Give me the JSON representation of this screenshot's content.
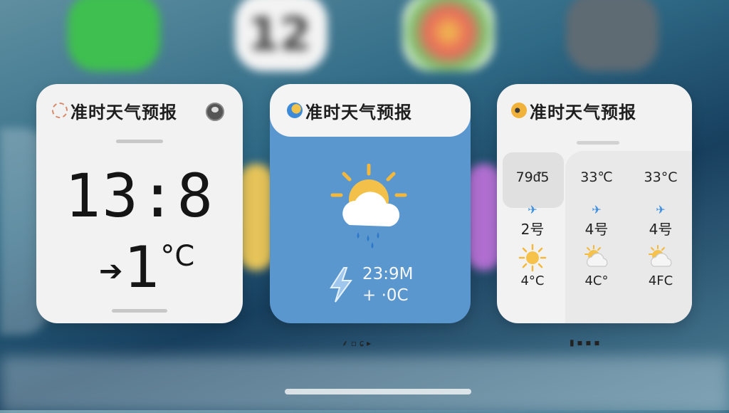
{
  "widgets": [
    {
      "title": "准时天气预报",
      "time": "13:8",
      "temp_arrow": "➔",
      "temp_value": "1",
      "temp_unit": "°C"
    },
    {
      "title": "准时天气预报",
      "line1": "23:9M",
      "line2": "+ ·0C",
      "icon": "partly-cloudy-rain-icon"
    },
    {
      "title": "准时天气预报",
      "columns": [
        {
          "temp": "79ᵭ5",
          "arrow": "✈",
          "level": "2号",
          "icon": "sun-icon",
          "low": "4°C"
        },
        {
          "temp": "33℃",
          "arrow": "✈",
          "level": "4号",
          "icon": "partly-cloudy-icon",
          "low": "4C°"
        },
        {
          "temp": "33°C",
          "arrow": "✈",
          "level": "4号",
          "icon": "partly-cloudy-icon",
          "low": "4FC"
        }
      ]
    }
  ],
  "page_indicators": {
    "center": "⸙ ▫ ɕ ▸",
    "right": "▮ ▪ ▪ ▪"
  },
  "colors": {
    "widget_blue": "#5a97cf",
    "sun": "#f3b83b",
    "accent_arrow": "#3c8ee0"
  },
  "background": {
    "calendar_date": "12"
  }
}
